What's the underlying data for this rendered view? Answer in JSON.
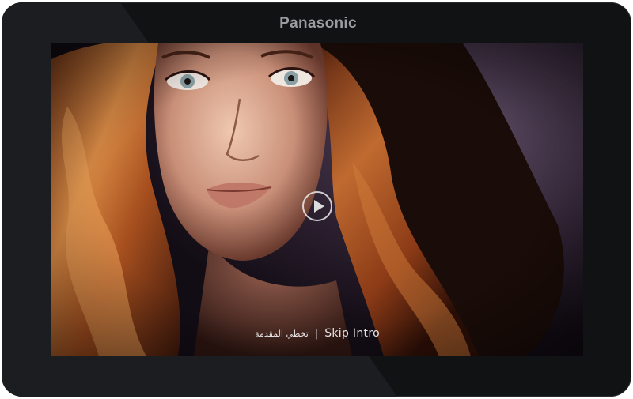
{
  "device": {
    "brand": "Panasonic",
    "bezel_color": "#111214"
  },
  "video": {
    "poster_subject": "woman-portrait",
    "play_icon": "play-icon"
  },
  "skip_intro": {
    "label_ar": "تخطي المقدمة",
    "separator": "|",
    "label_en": "Skip Intro"
  }
}
